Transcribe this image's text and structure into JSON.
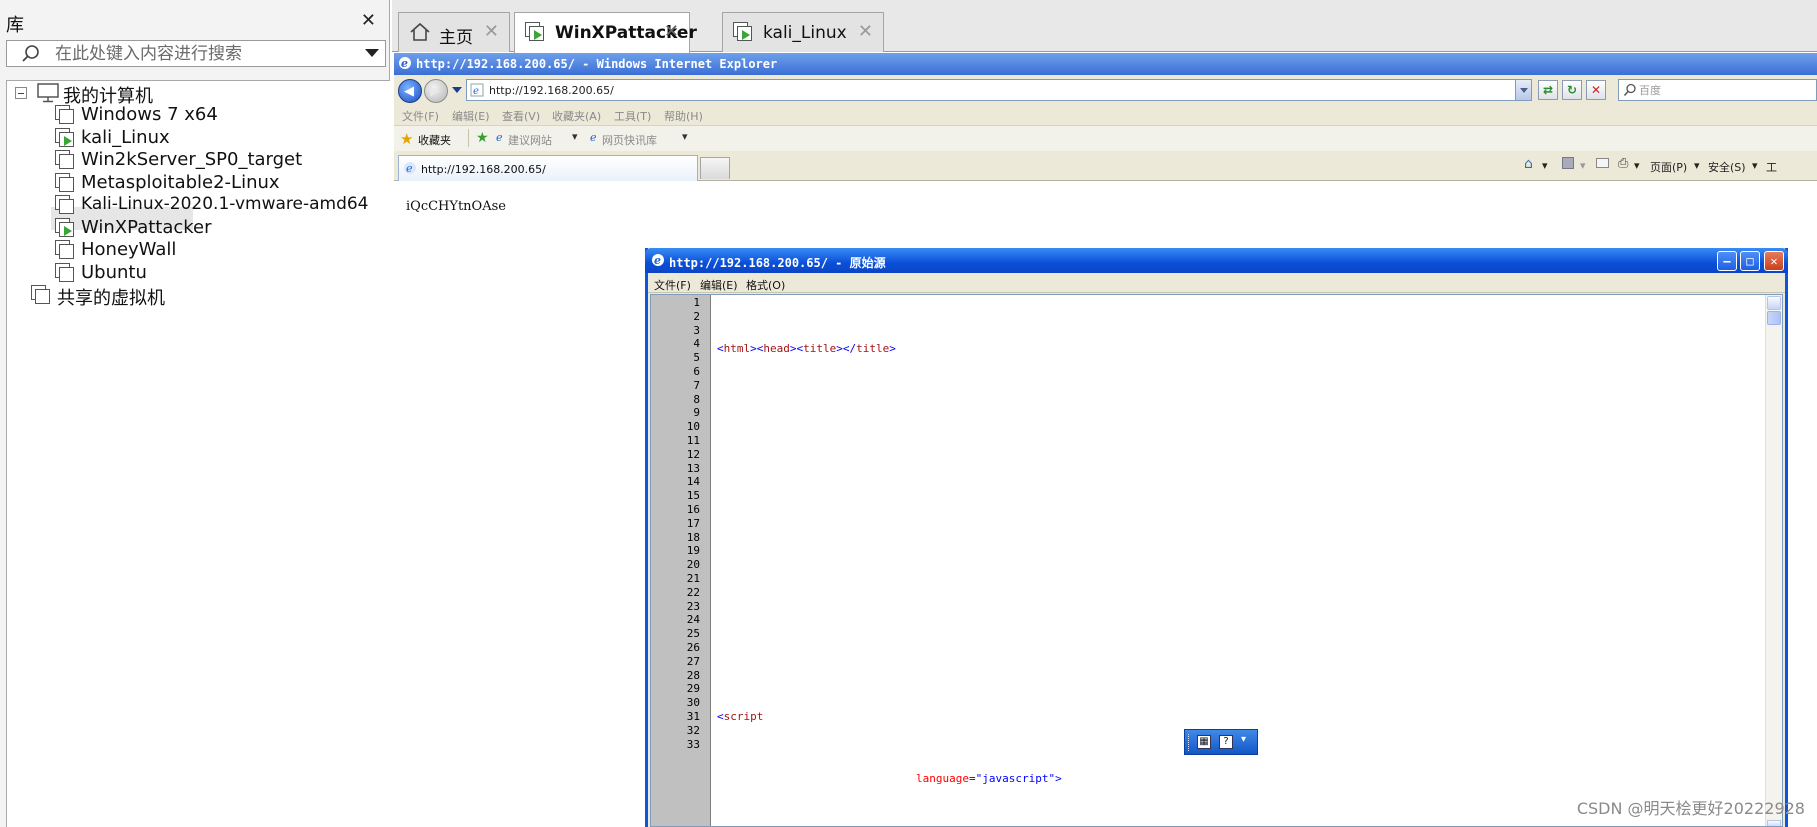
{
  "library": {
    "title": "库",
    "close": "✕",
    "search_placeholder": "在此处键入内容进行搜索",
    "root": "我的计算机",
    "vms": [
      {
        "name": "Windows 7 x64",
        "running": false
      },
      {
        "name": "kali_Linux",
        "running": true
      },
      {
        "name": "Win2kServer_SP0_target",
        "running": false
      },
      {
        "name": "Metasploitable2-Linux",
        "running": false
      },
      {
        "name": "Kali-Linux-2020.1-vmware-amd64",
        "running": false
      },
      {
        "name": "WinXPattacker",
        "running": true,
        "selected": true
      },
      {
        "name": "HoneyWall",
        "running": false
      },
      {
        "name": "Ubuntu",
        "running": false
      }
    ],
    "shared": "共享的虚拟机"
  },
  "tabs": [
    {
      "label": "主页",
      "close": "✕",
      "active": false
    },
    {
      "label": "WinXPattacker",
      "close": "✕",
      "active": true
    },
    {
      "label": "kali_Linux",
      "close": "✕",
      "active": false
    }
  ],
  "ie": {
    "title": "http://192.168.200.65/ - Windows Internet Explorer",
    "address": "http://192.168.200.65/",
    "search_placeholder": "百度",
    "menu": [
      "文件(F)",
      "编辑(E)",
      "查看(V)",
      "收藏夹(A)",
      "工具(T)",
      "帮助(H)"
    ],
    "favorites_label": "收藏夹",
    "fav_items": [
      "建议网站",
      "网页快讯库"
    ],
    "page_tab": "http://192.168.200.65/",
    "commands": [
      "页面(P)",
      "安全(S)",
      "工"
    ],
    "page_text": "iQcCHYtnOAse"
  },
  "source_window": {
    "title": "http://192.168.200.65/ - 原始源",
    "menu": [
      "文件(F)",
      "编辑(E)",
      "格式(O)"
    ],
    "line_numbers": [
      "1",
      "2",
      "3",
      "4",
      "5",
      "6",
      "7",
      "8",
      "9",
      "10",
      "11",
      "12",
      "13",
      "14",
      "15",
      "16",
      "17",
      "18",
      "19",
      "20",
      "21",
      "22",
      "23",
      "24",
      "25",
      "26",
      "27",
      "28",
      "29",
      "30",
      "31",
      "32",
      "33"
    ],
    "line4": {
      "html_open": "<html>",
      "head_open": "<head>",
      "title_open": "<title>",
      "title_close": "</title>"
    },
    "line27": "<script",
    "line31": {
      "attr": "language",
      "eq": "=",
      "val": "\"javascript\"",
      "close": ">"
    }
  },
  "ime": {
    "help": "?"
  },
  "watermark": "CSDN @明天桧更好20222928",
  "colors": {
    "tag": "#a31515",
    "bracket": "#0000ff",
    "attr": "#ff0000",
    "xp_blue": "#0a4fd8",
    "run_green": "#3aa637"
  }
}
